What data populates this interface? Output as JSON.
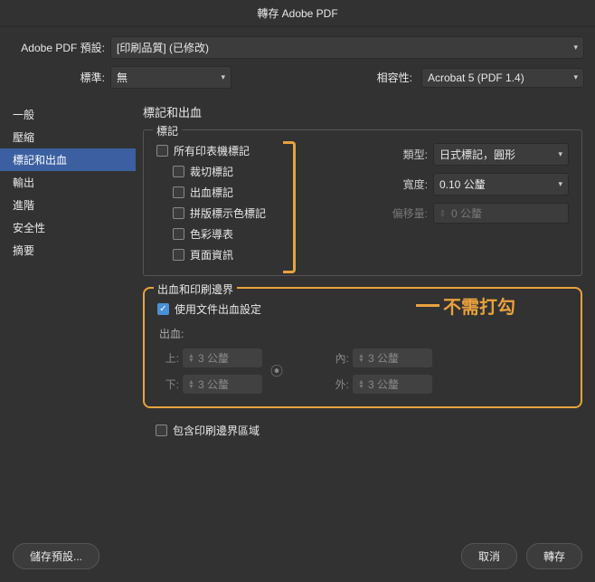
{
  "title": "轉存 Adobe PDF",
  "preset": {
    "label": "Adobe PDF 預設:",
    "value": "[印刷品質] (已修改)"
  },
  "standard": {
    "label": "標準:",
    "value": "無"
  },
  "compat": {
    "label": "相容性:",
    "value": "Acrobat 5 (PDF 1.4)"
  },
  "sidebar": {
    "items": [
      "一般",
      "壓縮",
      "標記和出血",
      "輸出",
      "進階",
      "安全性",
      "摘要"
    ],
    "active_index": 2
  },
  "section_title": "標記和出血",
  "marks": {
    "legend": "標記",
    "all_printers": "所有印表機標記",
    "trim": "裁切標記",
    "bleed_marks": "出血標記",
    "registration": "拼版標示色標記",
    "color_bars": "色彩導表",
    "page_info": "頁面資訊",
    "type_label": "類型:",
    "type_value": "日式標記，圓形",
    "width_label": "寬度:",
    "width_value": "0.10 公釐",
    "offset_label": "偏移量:",
    "offset_value": "0 公釐"
  },
  "callout_text": "不需打勾",
  "bleed": {
    "legend": "出血和印刷邊界",
    "use_doc": "使用文件出血設定",
    "heading": "出血:",
    "top_label": "上:",
    "top_value": "3 公釐",
    "bottom_label": "下:",
    "bottom_value": "3 公釐",
    "inside_label": "內:",
    "inside_value": "3 公釐",
    "outside_label": "外:",
    "outside_value": "3 公釐"
  },
  "include_slug": "包含印刷邊界區域",
  "footer": {
    "save_preset": "儲存預設...",
    "cancel": "取消",
    "export": "轉存"
  }
}
